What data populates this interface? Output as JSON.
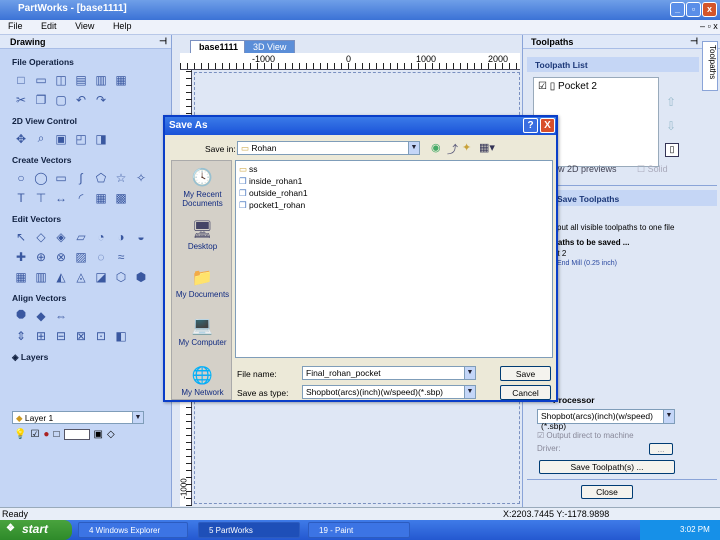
{
  "app": {
    "title": "PartWorks - [base1111]"
  },
  "menu": [
    "File",
    "Edit",
    "View",
    "Help"
  ],
  "left_panel": {
    "title": "Drawing",
    "sections": [
      {
        "label": "File Operations",
        "rows": [
          [
            "new-file-icon",
            "open-file-icon",
            "save-file-icon",
            "import-icon",
            "export-icon",
            "print-icon"
          ],
          [
            "cut-icon",
            "copy-icon",
            "paste-icon",
            "undo-icon",
            "redo-icon"
          ]
        ]
      },
      {
        "label": "2D View Control",
        "rows": [
          [
            "pan-icon",
            "zoom-icon",
            "zoom-fit-icon",
            "zoom-selection-icon",
            "view-icon"
          ]
        ]
      },
      {
        "label": "Create Vectors",
        "rows": [
          [
            "circle-icon",
            "ellipse-icon",
            "rectangle-icon",
            "polygon-icon",
            "star-icon",
            "star-outline-icon",
            "curve-icon"
          ],
          [
            "text-icon",
            "text-on-curve-icon",
            "dimension-icon",
            "arc-icon",
            "grid-icon",
            "bitmap-icon"
          ]
        ]
      },
      {
        "label": "Edit Vectors",
        "rows": [
          [
            "select-icon",
            "node-edit-icon",
            "transform-icon",
            "scale-icon",
            "break-icon",
            "join-icon",
            "trim-icon"
          ],
          [
            "weld-icon",
            "subtract-icon",
            "intersect-icon",
            "offset-icon",
            "fillet-icon",
            "smooth-icon"
          ],
          [
            "nest-icon",
            "array-icon",
            "mirror-icon",
            "shape-icon",
            "pentagon-icon",
            "hexagon-icon",
            "octagon-icon"
          ]
        ]
      },
      {
        "label": "Align Vectors",
        "rows": [
          [
            "center-align-icon",
            "h-center-icon",
            "v-center-icon"
          ],
          [
            "align-left-icon",
            "align-right-icon",
            "align-top-icon",
            "align-bottom-icon",
            "align-h-icon",
            "align-v-icon"
          ]
        ]
      }
    ],
    "layers": {
      "label": "Layers",
      "current": "Layer 1"
    }
  },
  "tabs": [
    "base1111",
    "3D View"
  ],
  "ruler": {
    "ticks": [
      "-1000",
      "0",
      "1000",
      "2000"
    ],
    "v_tick": "-1000"
  },
  "right_panel": {
    "title": "Toolpaths",
    "side_tab": "Toolpaths",
    "list_header": "Toolpath List",
    "items": [
      "Pocket 2"
    ],
    "show_2d": "ow 2D previews",
    "solid": "Solid",
    "save_header": "Save Toolpaths",
    "save_desc": "cput all visible toolpaths to one file",
    "to_be_saved": "paths to be saved ...",
    "saved_item": "et 2",
    "saved_tool": "End Mill (0.25 inch)",
    "processor_header": "Processor",
    "processor_value": "Shopbot(arcs)(inch)(w/speed)(*.sbp)",
    "output_direct": "Output direct to machine",
    "driver_label": "Driver:",
    "driver_btn": "...",
    "save_btn": "Save Toolpath(s) ...",
    "close_btn": "Close"
  },
  "status": {
    "text": "Ready",
    "coords": "X:2203.7445 Y:-1178.9898"
  },
  "taskbar": {
    "start": "start",
    "tasks": [
      "4 Windows Explorer",
      "5 PartWorks",
      "19 - Paint"
    ],
    "clock": "3:02 PM"
  },
  "dialog": {
    "title": "Save As",
    "save_in_label": "Save in:",
    "save_in_value": "Rohan",
    "places": [
      "My Recent Documents",
      "Desktop",
      "My Documents",
      "My Computer",
      "My Network"
    ],
    "files": [
      "ss",
      "inside_rohan1",
      "outside_rohan1",
      "pocket1_rohan"
    ],
    "filename_label": "File name:",
    "filename_value": "Final_rohan_pocket",
    "filetype_label": "Save as type:",
    "filetype_value": "Shopbot(arcs)(inch)(w/speed)(*.sbp)",
    "save_btn": "Save",
    "cancel_btn": "Cancel",
    "help_btn": "?",
    "close_btn": "X"
  }
}
